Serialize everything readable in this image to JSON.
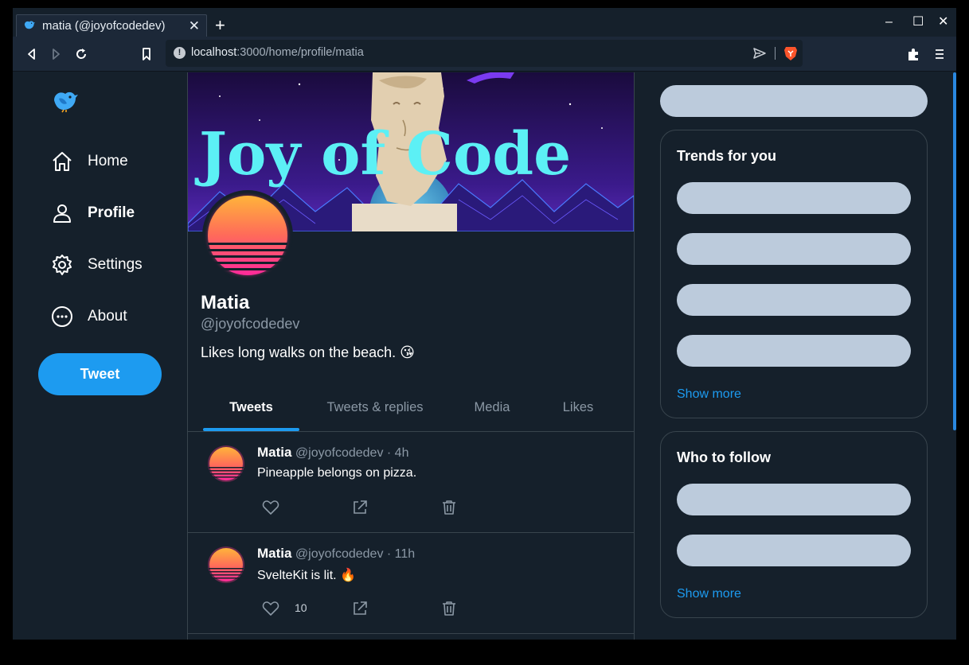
{
  "browser": {
    "tab_title": "matia (@joyofcodedev)",
    "tab_close": "✕",
    "new_tab": "+",
    "url_host": "localhost",
    "url_path": ":3000/home/profile/matia",
    "window_controls": {
      "minimize": "–",
      "maximize": "☐",
      "close": "✕"
    }
  },
  "sidebar": {
    "nav": [
      {
        "label": "Home",
        "icon": "home-icon",
        "active": false
      },
      {
        "label": "Profile",
        "icon": "user-icon",
        "active": true
      },
      {
        "label": "Settings",
        "icon": "gear-icon",
        "active": false
      },
      {
        "label": "About",
        "icon": "ellipsis-circle-icon",
        "active": false
      }
    ],
    "tweet_button": "Tweet"
  },
  "profile": {
    "banner_text": "Joy of Code",
    "name": "Matia",
    "handle": "@joyofcodedev",
    "bio": "Likes long walks on the beach. 😘",
    "tabs": [
      "Tweets",
      "Tweets & replies",
      "Media",
      "Likes"
    ],
    "active_tab": "Tweets"
  },
  "tweets": [
    {
      "author": "Matia",
      "meta": "@joyofcodedev · 4h",
      "text": "Pineapple belongs on pizza.",
      "likes": ""
    },
    {
      "author": "Matia",
      "meta": "@joyofcodedev · 11h",
      "text": "SvelteKit is lit. 🔥",
      "likes": "10"
    }
  ],
  "right": {
    "trends": {
      "title": "Trends for you",
      "show_more": "Show more"
    },
    "follow": {
      "title": "Who to follow",
      "show_more": "Show more"
    }
  },
  "colors": {
    "background": "#15202b",
    "accent": "#1d9bf0",
    "muted": "#8b98a5",
    "border": "#38444d",
    "skeleton": "#bccbdc"
  }
}
